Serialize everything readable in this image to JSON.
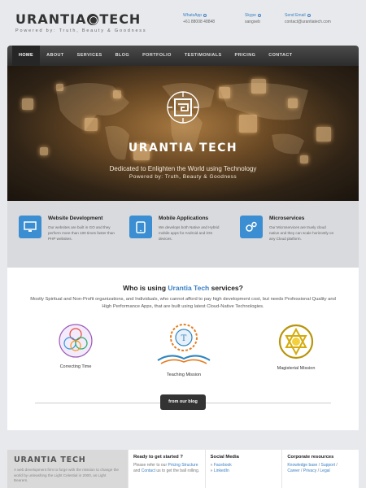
{
  "brand": {
    "name_a": "URANTIA",
    "name_b": "TECH",
    "tagline": "Powered by: Truth, Beauty & Goodness"
  },
  "header": {
    "contacts": [
      {
        "label": "WhatsApp",
        "value": "+61 88008 48848"
      },
      {
        "label": "Skype",
        "value": "sangseb"
      },
      {
        "label": "Send Email",
        "value": "contact@urantiatech.com"
      }
    ]
  },
  "nav": {
    "items": [
      "HOME",
      "ABOUT",
      "SERVICES",
      "BLOG",
      "PORTFOLIO",
      "TESTIMONIALS",
      "PRICING",
      "CONTACT"
    ],
    "active": 0
  },
  "hero": {
    "title": "URANTIA TECH",
    "subtitle": "Dedicated to Enlighten the World using Technology",
    "tagline": "Powered by: Truth, Beauty & Goodness"
  },
  "services": [
    {
      "icon": "monitor-icon",
      "title": "Website Development",
      "text": "Our websites are built in GO and they perform more than 100 times faster than PHP websites."
    },
    {
      "icon": "tablet-icon",
      "title": "Mobile Applications",
      "text": "We develops both Native and Hybrid mobile apps for Android and iOS devices."
    },
    {
      "icon": "gears-icon",
      "title": "Microservices",
      "text": "Our Microservices are truely cloud native and they can scale horizontly on any Cloud platform."
    }
  ],
  "who": {
    "heading_pre": "Who is using ",
    "heading_brand": "Urantia Tech",
    "heading_post": " services?",
    "description": "Mostly Spiritual and Non-Profit organizations, and Individuals, who cannot afford to pay high development cost, but needs Professional Quality and High Performance Apps, that are built using latest Cloud-Native Technologies.",
    "clients": [
      "Correcting Time",
      "Teaching Mission",
      "Magisterial Mission"
    ],
    "blog_button": "from our blog"
  },
  "footer": {
    "about_logo": "URANTIA TECH",
    "about_text": "A web development firm to forge with the mission to change the world by unleashing the Light Celestial in 2000, as Light Bearers.",
    "ready": {
      "title": "Ready to get started ?",
      "text_a": "Please refer to our ",
      "link_a": "Pricing Structure",
      "text_b": " and ",
      "link_b": "Contact",
      "text_c": " us to get the ball rolling."
    },
    "social": {
      "title": "Social Media",
      "items": [
        "Facebook",
        "LinkedIn"
      ]
    },
    "corporate": {
      "title": "Corporate resources",
      "items": [
        "Knowledge base",
        "Support",
        "Career",
        "Privacy",
        "Legal"
      ]
    }
  },
  "colors": {
    "accent": "#3b8ed1",
    "nav_bg": "#333333",
    "hero_glow": "#a87940"
  }
}
